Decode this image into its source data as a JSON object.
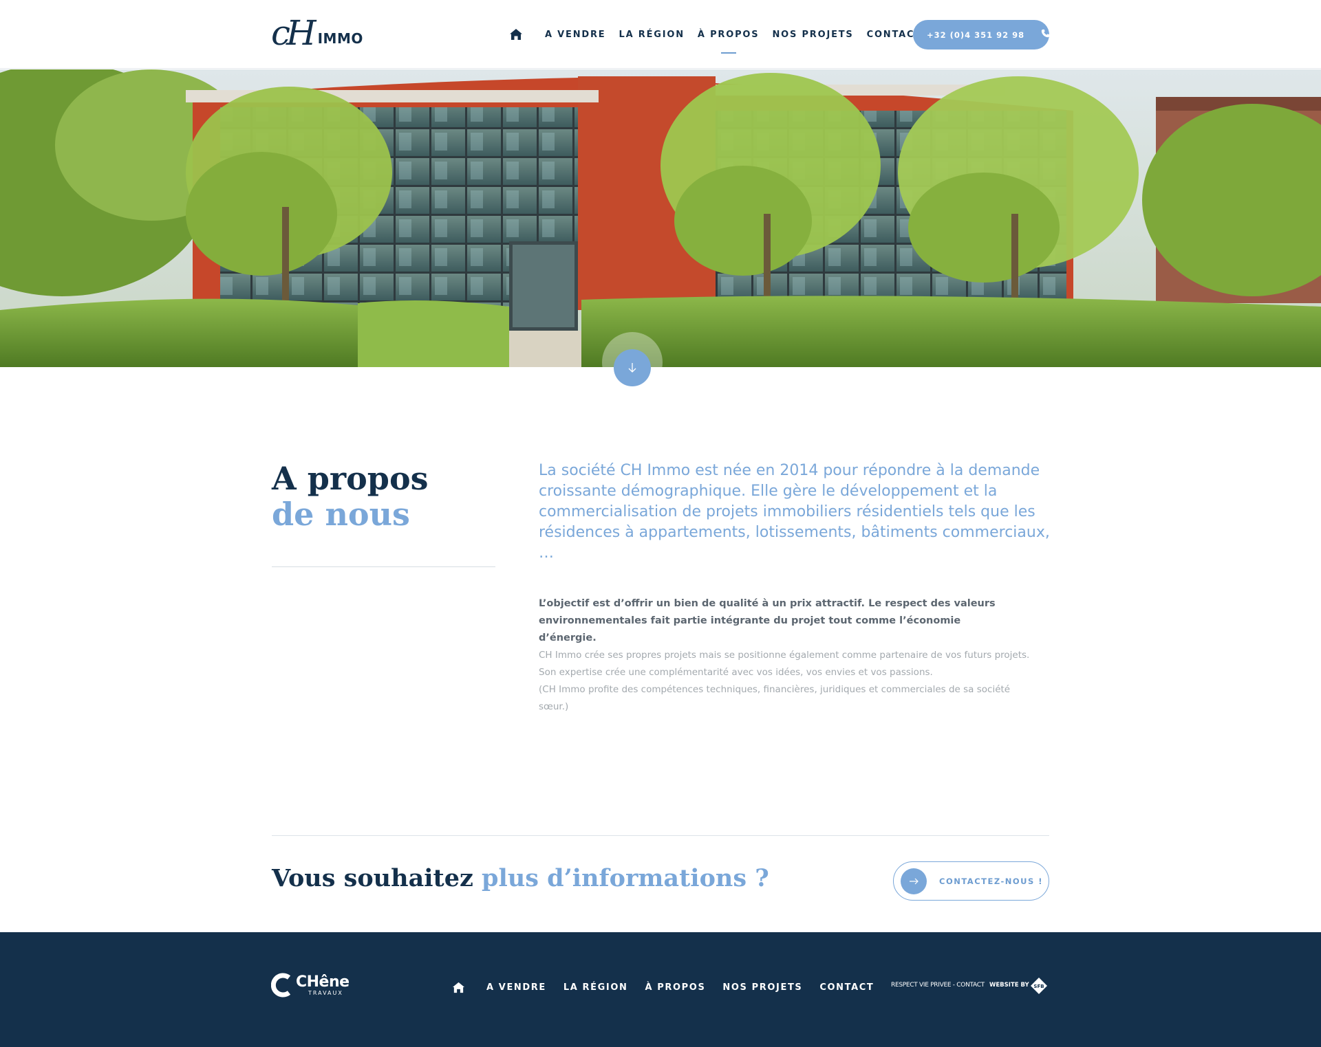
{
  "header": {
    "logo": {
      "mark": "cH",
      "text": "IMMO"
    },
    "nav": [
      {
        "label": "A VENDRE"
      },
      {
        "label": "LA RÉGION"
      },
      {
        "label": "À PROPOS",
        "active": true
      },
      {
        "label": "NOS PROJETS"
      },
      {
        "label": "CONTACT"
      }
    ],
    "phone": "+32 (0)4 351 92 98"
  },
  "hero": {
    "scroll_icon": "arrow-down-icon"
  },
  "about": {
    "title_line1": "A propos",
    "title_line2": "de nous",
    "lead": "La société CH Immo est née en 2014 pour répondre à la demande croissante démographique. Elle gère le développement et la commercialisation de projets immobiliers résidentiels tels que les résidences à appartements, lotissements, bâtiments commerciaux, …",
    "strong": "L’objectif est d’offrir un bien de qualité à un prix attractif. Le respect des valeurs environnementales fait partie intégrante du projet tout comme l’économie d’énergie.",
    "light_1": "CH Immo crée ses propres projets mais se positionne également comme partenaire de vos futurs projets. Son expertise crée une complémentarité avec vos idées, vos envies et vos passions.",
    "light_2": "(CH Immo profite des compétences techniques, financières, juridiques et commerciales de sa société sœur.)"
  },
  "cta": {
    "title_plain": "Vous souhaitez ",
    "title_accent": "plus d’informations ?",
    "button_label": "CONTACTEZ-NOUS !"
  },
  "footer": {
    "logo_name": "CHêne",
    "logo_sub": "TRAVAUX",
    "nav": [
      {
        "label": "A VENDRE"
      },
      {
        "label": "LA RÉGION"
      },
      {
        "label": "À PROPOS"
      },
      {
        "label": "NOS PROJETS"
      },
      {
        "label": "CONTACT"
      }
    ],
    "legal": "RESPECT VIE PRIVEE - CONTACT",
    "website_by": "WEBSITE BY",
    "agency": "SFB"
  },
  "colors": {
    "navy": "#14304b",
    "accent_blue": "#7aa7d9",
    "text_grey": "#5c6670",
    "light_grey": "#a3a9ae"
  }
}
